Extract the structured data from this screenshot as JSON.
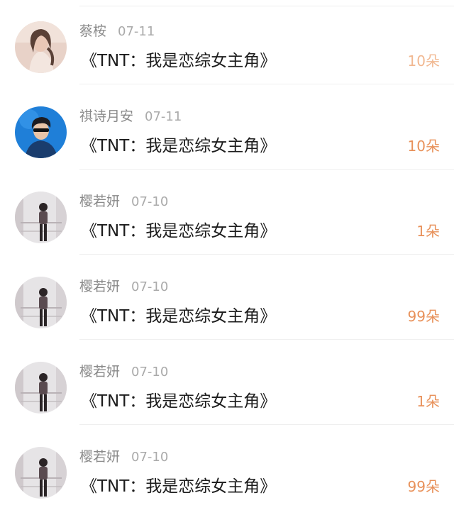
{
  "gifts": [
    {
      "name": "蔡桉",
      "date": "07-11",
      "title": "《TNT：我是恋综女主角》",
      "count": "10朵",
      "avatar": "woman-photo-avatar"
    },
    {
      "name": "祺诗月安",
      "date": "07-11",
      "title": "《TNT：我是恋综女主角》",
      "count": "10朵",
      "avatar": "man-blue-photo-avatar"
    },
    {
      "name": "樱若妍",
      "date": "07-10",
      "title": "《TNT：我是恋综女主角》",
      "count": "1朵",
      "avatar": "man-standing-photo-avatar"
    },
    {
      "name": "樱若妍",
      "date": "07-10",
      "title": "《TNT：我是恋综女主角》",
      "count": "99朵",
      "avatar": "man-standing-photo-avatar"
    },
    {
      "name": "樱若妍",
      "date": "07-10",
      "title": "《TNT：我是恋综女主角》",
      "count": "1朵",
      "avatar": "man-standing-photo-avatar"
    },
    {
      "name": "樱若妍",
      "date": "07-10",
      "title": "《TNT：我是恋综女主角》",
      "count": "99朵",
      "avatar": "man-standing-photo-avatar"
    }
  ],
  "colors": {
    "count_accent": "#e8915a",
    "name_text": "#8a8a8a",
    "title_text": "#1c1c1c"
  }
}
